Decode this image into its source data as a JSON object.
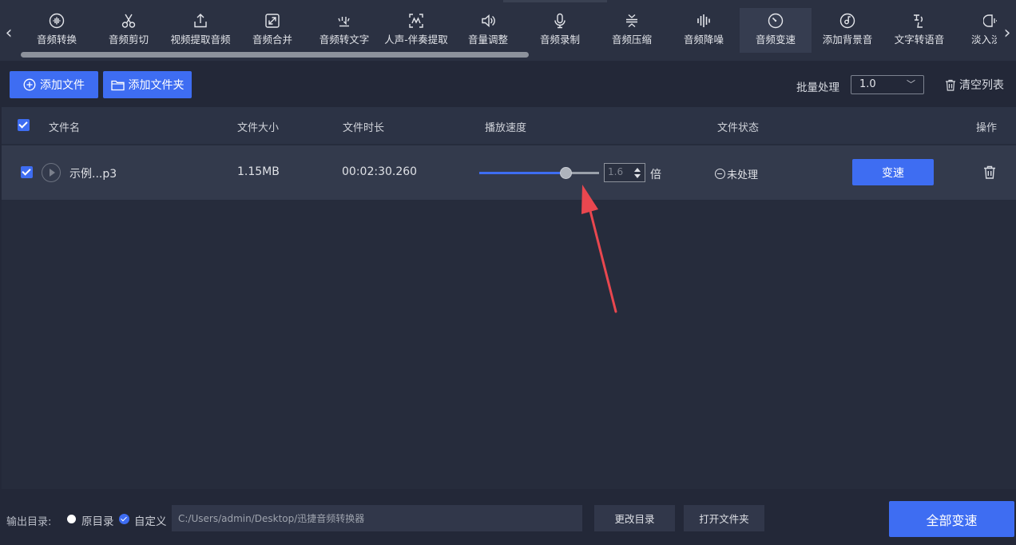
{
  "toolbar": {
    "tools": [
      {
        "label": "音频转换",
        "icon": "audio-wave-icon"
      },
      {
        "label": "音频剪切",
        "icon": "scissors-icon"
      },
      {
        "label": "视频提取音频",
        "icon": "upload-icon"
      },
      {
        "label": "音频合并",
        "icon": "merge-icon"
      },
      {
        "label": "音频转文字",
        "icon": "speech-text-icon"
      },
      {
        "label": "人声-伴奏提取",
        "icon": "voice-extract-icon"
      },
      {
        "label": "音量调整",
        "icon": "speaker-icon"
      },
      {
        "label": "音频录制",
        "icon": "microphone-icon"
      },
      {
        "label": "音频压缩",
        "icon": "compress-icon"
      },
      {
        "label": "音频降噪",
        "icon": "equalizer-icon"
      },
      {
        "label": "音频变速",
        "icon": "speedometer-icon"
      },
      {
        "label": "添加背景音",
        "icon": "disc-icon"
      },
      {
        "label": "文字转语音",
        "icon": "text-speech-icon"
      },
      {
        "label": "淡入淡出",
        "icon": "fade-icon"
      }
    ],
    "active_index": 10,
    "scroll_fraction": 0.52
  },
  "actions": {
    "add_file": "添加文件",
    "add_folder": "添加文件夹",
    "batch_label": "批量处理",
    "batch_value": "1.0",
    "clear_list": "清空列表"
  },
  "table": {
    "headers": {
      "name": "文件名",
      "size": "文件大小",
      "duration": "文件时长",
      "speed": "播放速度",
      "status": "文件状态",
      "ops": "操作"
    },
    "rows": [
      {
        "checked": true,
        "name": "示例...p3",
        "size": "1.15MB",
        "duration": "00:02:30.260",
        "speed_slider_fraction": 0.72,
        "speed_value": "1.6",
        "speed_unit": "倍",
        "status": "未处理",
        "action_label": "变速"
      }
    ]
  },
  "bottom": {
    "output_label": "输出目录:",
    "radio_original": "原目录",
    "radio_custom": "自定义",
    "path": "C:/Users/admin/Desktop/迅捷音频转换器",
    "change_dir": "更改目录",
    "open_folder": "打开文件夹",
    "convert_all": "全部变速"
  },
  "colors": {
    "accent": "#3e6df2",
    "annotation": "#e9474f"
  }
}
